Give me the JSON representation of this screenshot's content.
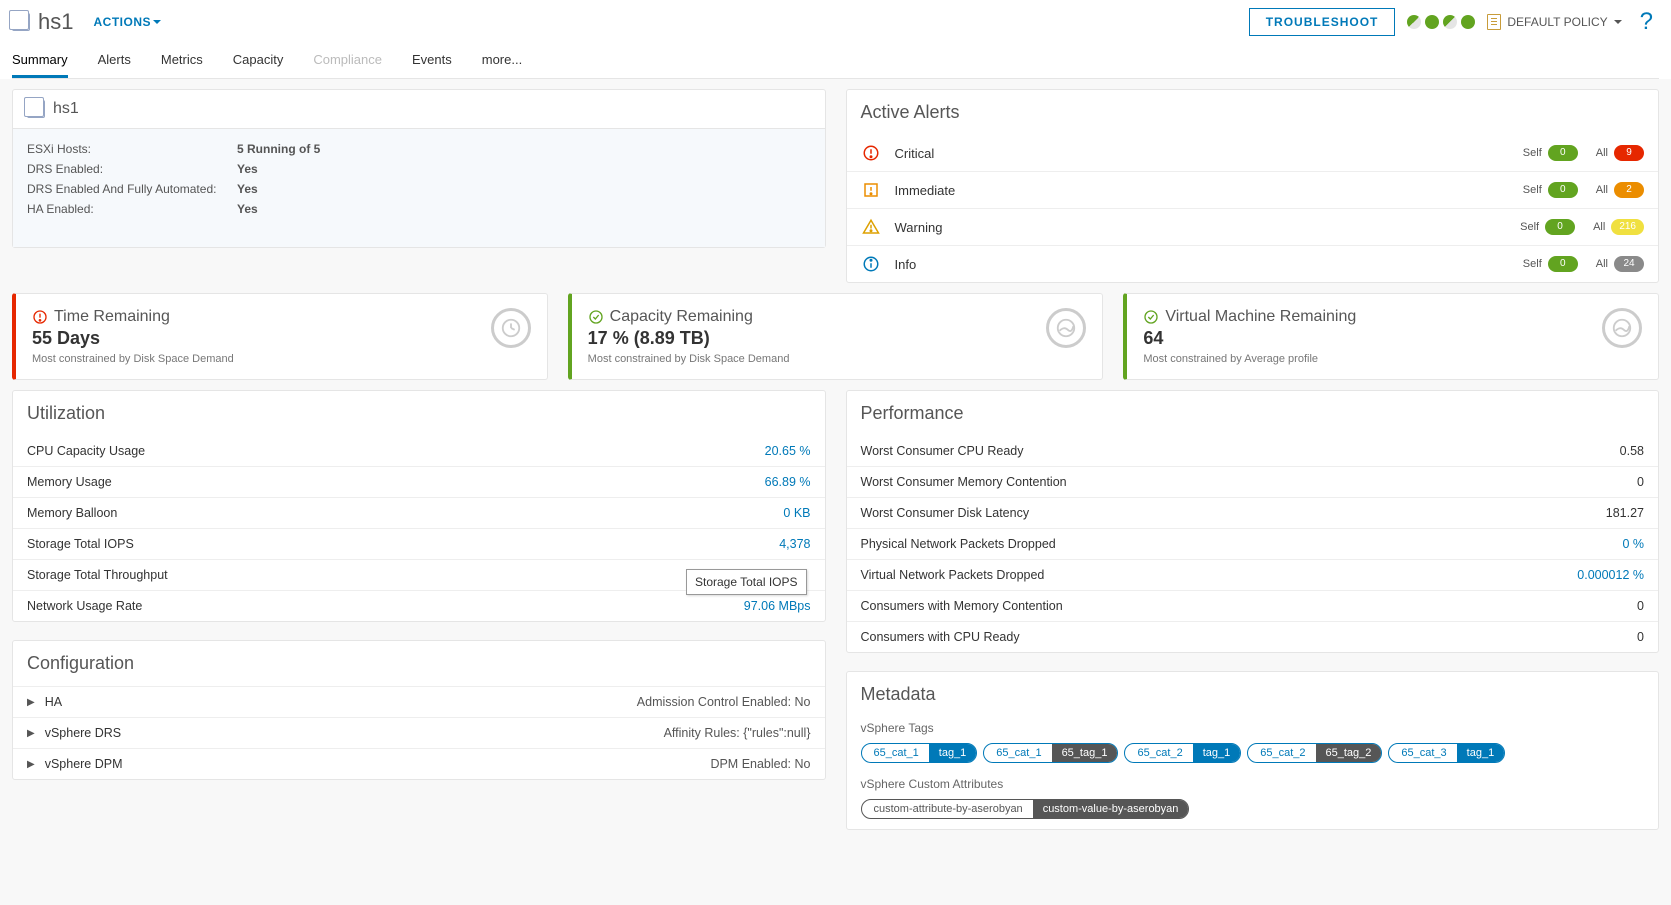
{
  "header": {
    "title": "hs1",
    "actions_label": "ACTIONS",
    "troubleshoot_label": "TROUBLESHOOT",
    "policy_label": "DEFAULT POLICY"
  },
  "tabs": [
    "Summary",
    "Alerts",
    "Metrics",
    "Capacity",
    "Compliance",
    "Events",
    "more..."
  ],
  "about": {
    "title": "hs1",
    "rows": [
      {
        "label": "ESXi Hosts:",
        "value": "5 Running of 5"
      },
      {
        "label": "DRS Enabled:",
        "value": "Yes"
      },
      {
        "label": "DRS Enabled And Fully Automated:",
        "value": "Yes"
      },
      {
        "label": "HA Enabled:",
        "value": "Yes"
      }
    ]
  },
  "alerts": {
    "title": "Active Alerts",
    "rows": [
      {
        "name": "Critical",
        "self": "0",
        "all": "9",
        "all_cls": "pill-red"
      },
      {
        "name": "Immediate",
        "self": "0",
        "all": "2",
        "all_cls": "pill-orange"
      },
      {
        "name": "Warning",
        "self": "0",
        "all": "216",
        "all_cls": "pill-yellow"
      },
      {
        "name": "Info",
        "self": "0",
        "all": "24",
        "all_cls": "pill-grey"
      }
    ],
    "self_label": "Self",
    "all_label": "All"
  },
  "capacity": {
    "cards": [
      {
        "title": "Time Remaining",
        "value": "55 Days",
        "sub": "Most constrained by Disk Space Demand",
        "cls": "red"
      },
      {
        "title": "Capacity Remaining",
        "value": "17 % (8.89 TB)",
        "sub": "Most constrained by Disk Space Demand",
        "cls": ""
      },
      {
        "title": "Virtual Machine Remaining",
        "value": "64",
        "sub": "Most constrained by Average profile",
        "cls": ""
      }
    ]
  },
  "utilization": {
    "title": "Utilization",
    "rows": [
      {
        "label": "CPU Capacity Usage",
        "value": "20.65 %"
      },
      {
        "label": "Memory Usage",
        "value": "66.89 %"
      },
      {
        "label": "Memory Balloon",
        "value": "0 KB"
      },
      {
        "label": "Storage Total IOPS",
        "value": "4,378"
      },
      {
        "label": "Storage Total Throughput",
        "value": ""
      },
      {
        "label": "Network Usage Rate",
        "value": "97.06 MBps"
      }
    ],
    "tooltip": "Storage Total IOPS"
  },
  "performance": {
    "title": "Performance",
    "rows": [
      {
        "label": "Worst Consumer CPU Ready",
        "value": "0.58",
        "dark": true
      },
      {
        "label": "Worst Consumer Memory Contention",
        "value": "0",
        "dark": true
      },
      {
        "label": "Worst Consumer Disk Latency",
        "value": "181.27",
        "dark": true
      },
      {
        "label": "Physical Network Packets Dropped",
        "value": "0 %",
        "dark": false
      },
      {
        "label": "Virtual Network Packets Dropped",
        "value": "0.000012 %",
        "dark": false
      },
      {
        "label": "Consumers with Memory Contention",
        "value": "0",
        "dark": true
      },
      {
        "label": "Consumers with CPU Ready",
        "value": "0",
        "dark": true
      }
    ]
  },
  "configuration": {
    "title": "Configuration",
    "rows": [
      {
        "left": "HA",
        "right": "Admission Control Enabled: No"
      },
      {
        "left": "vSphere DRS",
        "right": "Affinity Rules: {\"rules\":null}"
      },
      {
        "left": "vSphere DPM",
        "right": "DPM Enabled: No"
      }
    ]
  },
  "metadata": {
    "title": "Metadata",
    "tags_label": "vSphere Tags",
    "tags": [
      {
        "cat": "65_cat_1",
        "val": "tag_1",
        "alt": false
      },
      {
        "cat": "65_cat_1",
        "val": "65_tag_1",
        "alt": true
      },
      {
        "cat": "65_cat_2",
        "val": "tag_1",
        "alt": false
      },
      {
        "cat": "65_cat_2",
        "val": "65_tag_2",
        "alt": true
      },
      {
        "cat": "65_cat_3",
        "val": "tag_1",
        "alt": false
      }
    ],
    "attrs_label": "vSphere Custom Attributes",
    "attrs": [
      {
        "cat": "custom-attribute-by-aserobyan",
        "val": "custom-value-by-aserobyan"
      }
    ]
  }
}
